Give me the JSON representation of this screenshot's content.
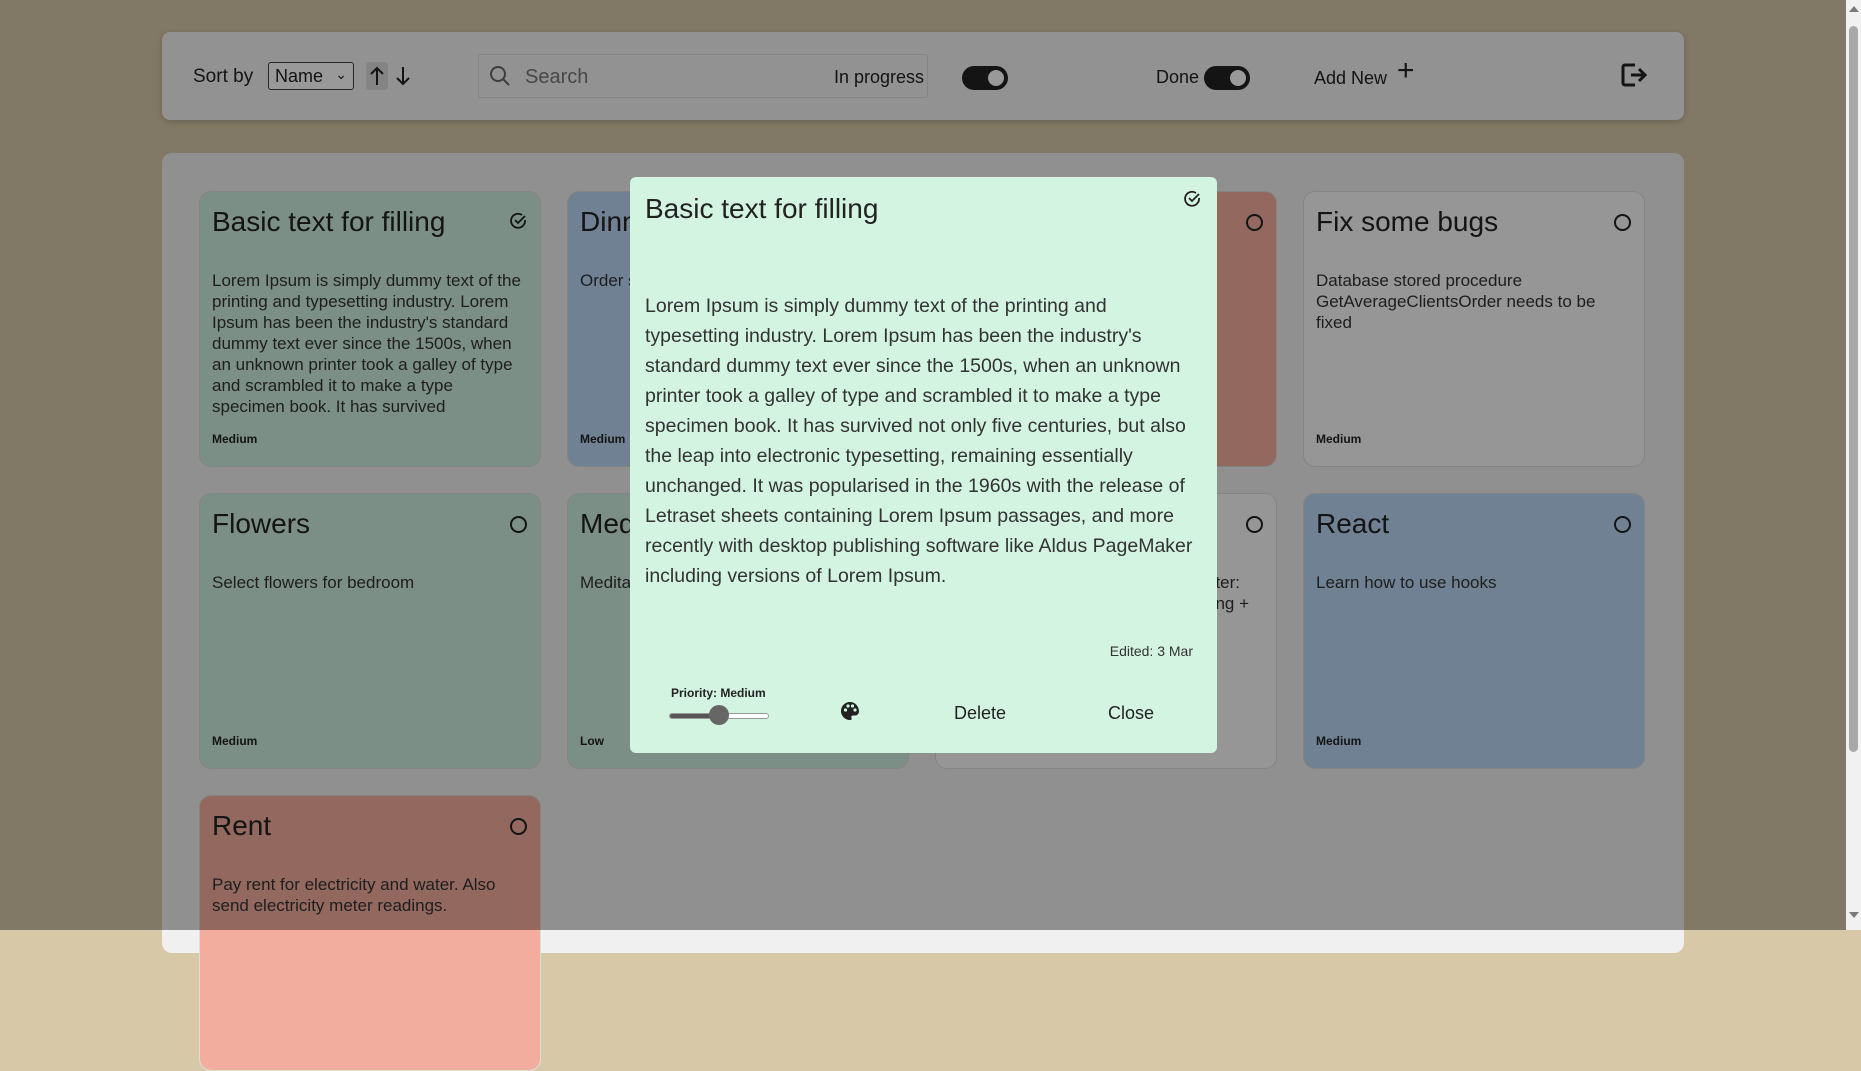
{
  "toolbar": {
    "sort_label": "Sort by",
    "sort_value": "Name",
    "search_placeholder": "Search",
    "in_progress_label": "In progress",
    "in_progress_on": true,
    "done_label": "Done",
    "done_on": true,
    "add_new_label": "Add New"
  },
  "cards": [
    {
      "title": "Basic text for filling",
      "desc": "Lorem Ipsum is simply dummy text of the printing and typesetting industry. Lorem Ipsum has been the industry's standard dummy text ever since the 1500s, when an unknown printer took a galley of type and scrambled it to make a type specimen book. It has survived",
      "priority": "Medium",
      "color": "#cfeee0",
      "done": true
    },
    {
      "title": "Dinn",
      "desc": "Order s",
      "priority": "Medium",
      "color": "#b9d8f4",
      "done": false
    },
    {
      "title": "",
      "desc": "",
      "priority": "",
      "color": "#f3ad9f",
      "done": false
    },
    {
      "title": "Fix some bugs",
      "desc": "Database stored procedure GetAverageClientsOrder needs to be fixed",
      "priority": "Medium",
      "color": "#fafafa",
      "done": false
    },
    {
      "title": "Flowers",
      "desc": "Select flowers for bedroom",
      "priority": "Medium",
      "color": "#cfeee0",
      "done": false
    },
    {
      "title": "Med",
      "desc": "Medita",
      "priority": "Low",
      "color": "#cfeee0",
      "done": false
    },
    {
      "title": "",
      "desc": "nter: ring +",
      "priority": "",
      "color": "#fafafa",
      "done": false
    },
    {
      "title": "React",
      "desc": "Learn how to use hooks",
      "priority": "Medium",
      "color": "#b9d8f4",
      "done": false
    },
    {
      "title": "Rent",
      "desc": "Pay rent for electricity and water. Also send electricity meter readings.",
      "priority": "",
      "color": "#f3ad9f",
      "done": false
    }
  ],
  "modal": {
    "title": "Basic text for filling",
    "body": "Lorem Ipsum is simply dummy text of the printing and typesetting industry. Lorem Ipsum has been the industry's standard dummy text ever since the 1500s, when an unknown printer took a galley of type and scrambled it to make a type specimen book. It has survived not only five centuries, but also the leap into electronic typesetting, remaining essentially unchanged. It was popularised in the 1960s with the release of Letraset sheets containing Lorem Ipsum passages, and more recently with desktop publishing software like Aldus PageMaker including versions of Lorem Ipsum.",
    "edited": "Edited: 3 Mar",
    "priority_label": "Priority: Medium",
    "priority_level": 0.5,
    "delete_label": "Delete",
    "close_label": "Close",
    "bg_color": "#d2f4e1"
  },
  "icons": {
    "search": "search-icon",
    "sort_asc": "arrow-up-icon",
    "sort_desc": "arrow-down-icon",
    "add": "plus-icon",
    "logout": "logout-icon",
    "card_done": "check-circle-icon",
    "card_todo": "circle-icon",
    "palette": "palette-icon"
  }
}
